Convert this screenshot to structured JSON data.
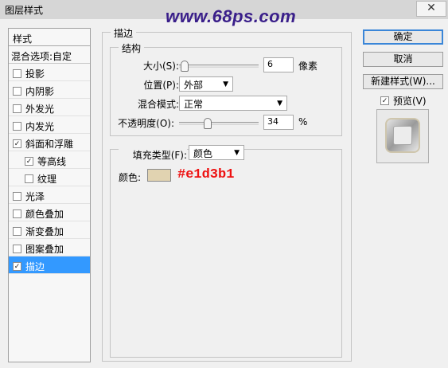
{
  "window": {
    "title": "图层样式",
    "close_symbol": "✕"
  },
  "watermark": "www.68ps.com",
  "left_panel": {
    "header": "样式",
    "blend_options": "混合选项:自定",
    "items": [
      {
        "label": "投影",
        "checked": false,
        "sub": false,
        "active": false
      },
      {
        "label": "内阴影",
        "checked": false,
        "sub": false,
        "active": false
      },
      {
        "label": "外发光",
        "checked": false,
        "sub": false,
        "active": false
      },
      {
        "label": "内发光",
        "checked": false,
        "sub": false,
        "active": false
      },
      {
        "label": "斜面和浮雕",
        "checked": true,
        "sub": false,
        "active": false
      },
      {
        "label": "等高线",
        "checked": true,
        "sub": true,
        "active": false
      },
      {
        "label": "纹理",
        "checked": false,
        "sub": true,
        "active": false
      },
      {
        "label": "光泽",
        "checked": false,
        "sub": false,
        "active": false
      },
      {
        "label": "颜色叠加",
        "checked": false,
        "sub": false,
        "active": false
      },
      {
        "label": "渐变叠加",
        "checked": false,
        "sub": false,
        "active": false
      },
      {
        "label": "图案叠加",
        "checked": false,
        "sub": false,
        "active": false
      },
      {
        "label": "描边",
        "checked": true,
        "sub": false,
        "active": true
      }
    ]
  },
  "stroke": {
    "section_title": "描边",
    "structure": {
      "title": "结构",
      "size_label": "大小(S):",
      "size_value": "6",
      "size_unit": "像素",
      "size_slider": 0.02,
      "position_label": "位置(P):",
      "position_value": "外部",
      "blend_mode_label": "混合模式:",
      "blend_mode_value": "正常",
      "opacity_label": "不透明度(O):",
      "opacity_value": "34",
      "opacity_unit": "%",
      "opacity_slider": 0.34
    },
    "fill": {
      "fill_type_label": "填充类型(F):",
      "fill_type_value": "颜色",
      "color_label": "颜色:",
      "color_hex": "#e1d3b1",
      "color_annotation": "#e1d3b1"
    }
  },
  "buttons": {
    "ok": "确定",
    "cancel": "取消",
    "new_style": "新建样式(W)...",
    "preview_label": "预览(V)",
    "preview_checked": true
  },
  "colors": {
    "accent": "#3399ff",
    "annotation": "#ee1111",
    "watermark": "#3a1f8a"
  }
}
